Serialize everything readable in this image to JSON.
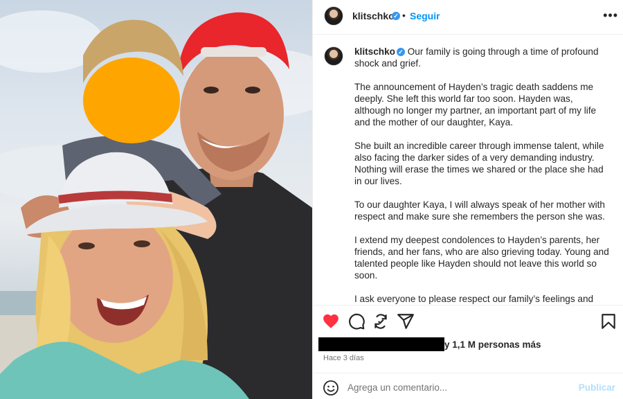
{
  "post": {
    "username": "klitschko",
    "verified_mark": "✓",
    "separator": "•",
    "follow_label": "Seguir",
    "more_icon": "more-horizontal-icon"
  },
  "caption": {
    "username": "klitschko",
    "paragraphs": [
      "Our family is going through a time of profound shock and grief.",
      "The announcement of Hayden’s tragic death saddens me deeply. She left this world far too soon. Hayden was, although no longer my partner, an important part of my life and the mother of our daughter, Kaya.",
      "She built an incredible career through immense talent, while also facing the darker sides of a very demanding industry. Nothing will erase the times we shared or the place she had in our lives.",
      "To our daughter Kaya, I will always speak of her mother with respect and make sure she remembers the person she was.",
      "I extend my deepest condolences to Hayden’s parents, her friends, and her fans, who are also grieving today. Young and talented people like Hayden should not leave this world so soon.",
      "I ask everyone to please respect our family’s feelings and privacy during this incredibly difficult time. For now, this is all I wish to say."
    ]
  },
  "actions": {
    "icons": [
      "heart-filled-icon",
      "comment-icon",
      "share-repost-icon",
      "send-icon",
      "bookmark-icon"
    ],
    "like_color": "#ff3040"
  },
  "likes": {
    "text": "y 1,1 M personas más"
  },
  "timestamp": "Hace 3 días",
  "comment": {
    "placeholder": "Agrega un comentario...",
    "value": "",
    "post_label": "Publicar",
    "post_color": "#b2dffc"
  },
  "colors": {
    "accent": "#0095f6",
    "verified": "#3797f0",
    "redaction_face": "#ffa500"
  }
}
